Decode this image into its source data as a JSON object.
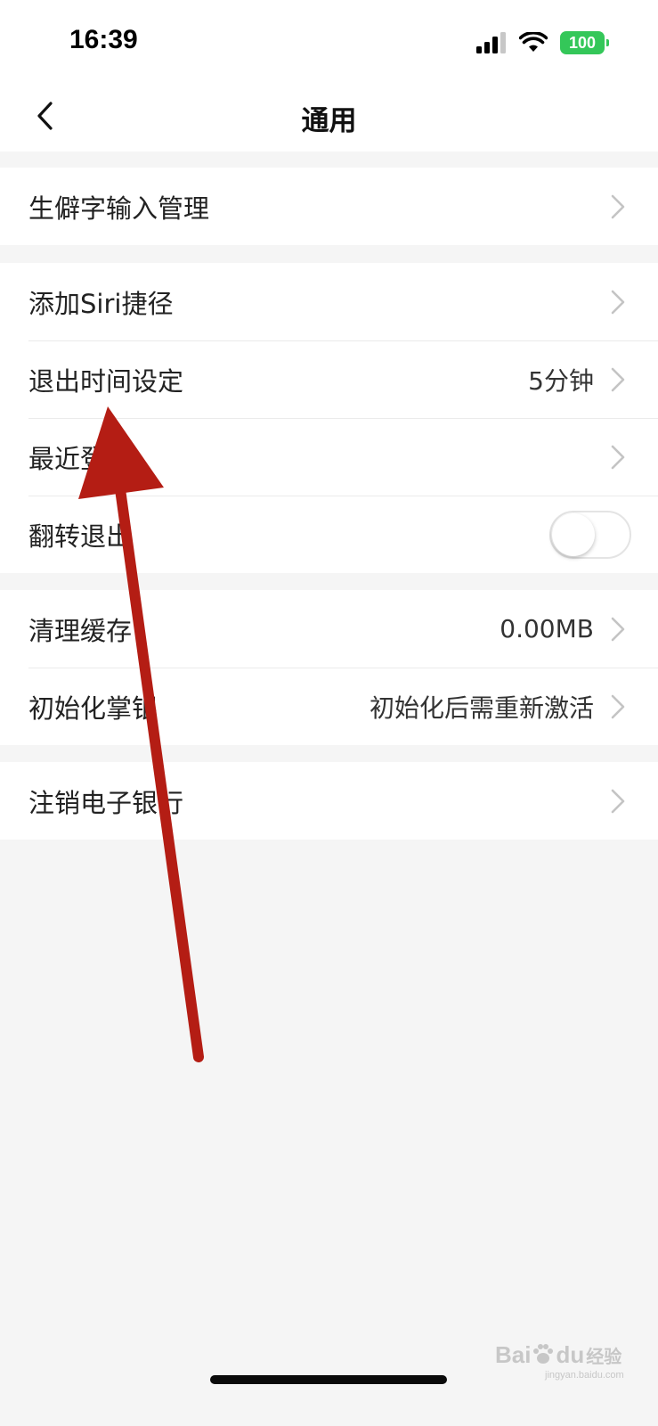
{
  "status_bar": {
    "time": "16:39",
    "battery": "100",
    "signal_icon": "cellular-signal-icon",
    "wifi_icon": "wifi-icon"
  },
  "nav": {
    "title": "通用",
    "back_icon": "chevron-left-icon"
  },
  "groups": [
    {
      "items": [
        {
          "label": "生僻字输入管理",
          "value": ""
        }
      ]
    },
    {
      "items": [
        {
          "label": "添加Siri捷径",
          "value": ""
        },
        {
          "label": "退出时间设定",
          "value": "5分钟"
        },
        {
          "label": "最近登录",
          "value": ""
        },
        {
          "label": "翻转退出",
          "toggle": false
        }
      ]
    },
    {
      "items": [
        {
          "label": "清理缓存",
          "value": "0.00MB"
        },
        {
          "label": "初始化掌银",
          "value": "初始化后需重新激活"
        }
      ]
    },
    {
      "items": [
        {
          "label": "注销电子银行",
          "value": ""
        }
      ]
    }
  ],
  "watermark": {
    "brand": "Bai",
    "brand2": "du",
    "suffix": "经验",
    "url": "jingyan.baidu.com"
  },
  "colors": {
    "battery_green": "#34c759",
    "arrow_red": "#b41d14",
    "background": "#f5f5f5"
  }
}
